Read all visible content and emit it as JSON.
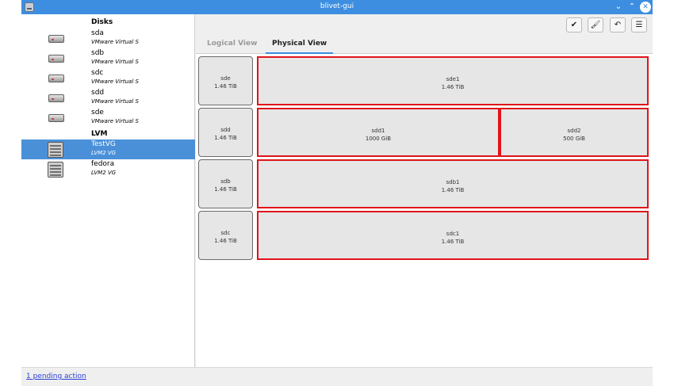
{
  "window": {
    "title": "blivet-gui"
  },
  "sidebar": {
    "disks_header": "Disks",
    "lvm_header": "LVM",
    "disks": [
      {
        "name": "sda",
        "desc": "VMware Virtual S"
      },
      {
        "name": "sdb",
        "desc": "VMware Virtual S"
      },
      {
        "name": "sdc",
        "desc": "VMware Virtual S"
      },
      {
        "name": "sdd",
        "desc": "VMware Virtual S"
      },
      {
        "name": "sde",
        "desc": "VMware Virtual S"
      }
    ],
    "lvm": [
      {
        "name": "TestVG",
        "desc": "LVM2 VG",
        "selected": true
      },
      {
        "name": "fedora",
        "desc": "LVM2 VG",
        "selected": false
      }
    ]
  },
  "toolbar": {
    "apply": "✔",
    "clear": "🖌",
    "undo": "↶",
    "menu": "☰"
  },
  "tabs": {
    "logical": "Logical View",
    "physical": "Physical View"
  },
  "physical_view": [
    {
      "disk": "sde",
      "size": "1.46 TiB",
      "parts": [
        {
          "name": "sde1",
          "size": "1.46 TiB"
        }
      ]
    },
    {
      "disk": "sdd",
      "size": "1.46 TiB",
      "parts": [
        {
          "name": "sdd1",
          "size": "1000 GiB"
        },
        {
          "name": "sdd2",
          "size": "500 GiB"
        }
      ]
    },
    {
      "disk": "sdb",
      "size": "1.46 TiB",
      "parts": [
        {
          "name": "sdb1",
          "size": "1.46 TiB"
        }
      ]
    },
    {
      "disk": "sdc",
      "size": "1.46 TiB",
      "parts": [
        {
          "name": "sdc1",
          "size": "1.46 TiB"
        }
      ]
    }
  ],
  "status": {
    "pending": "1 pending action"
  },
  "colors": {
    "accent": "#3d8ee0",
    "selection": "#4a90d9",
    "partition_border": "#e0141a"
  }
}
